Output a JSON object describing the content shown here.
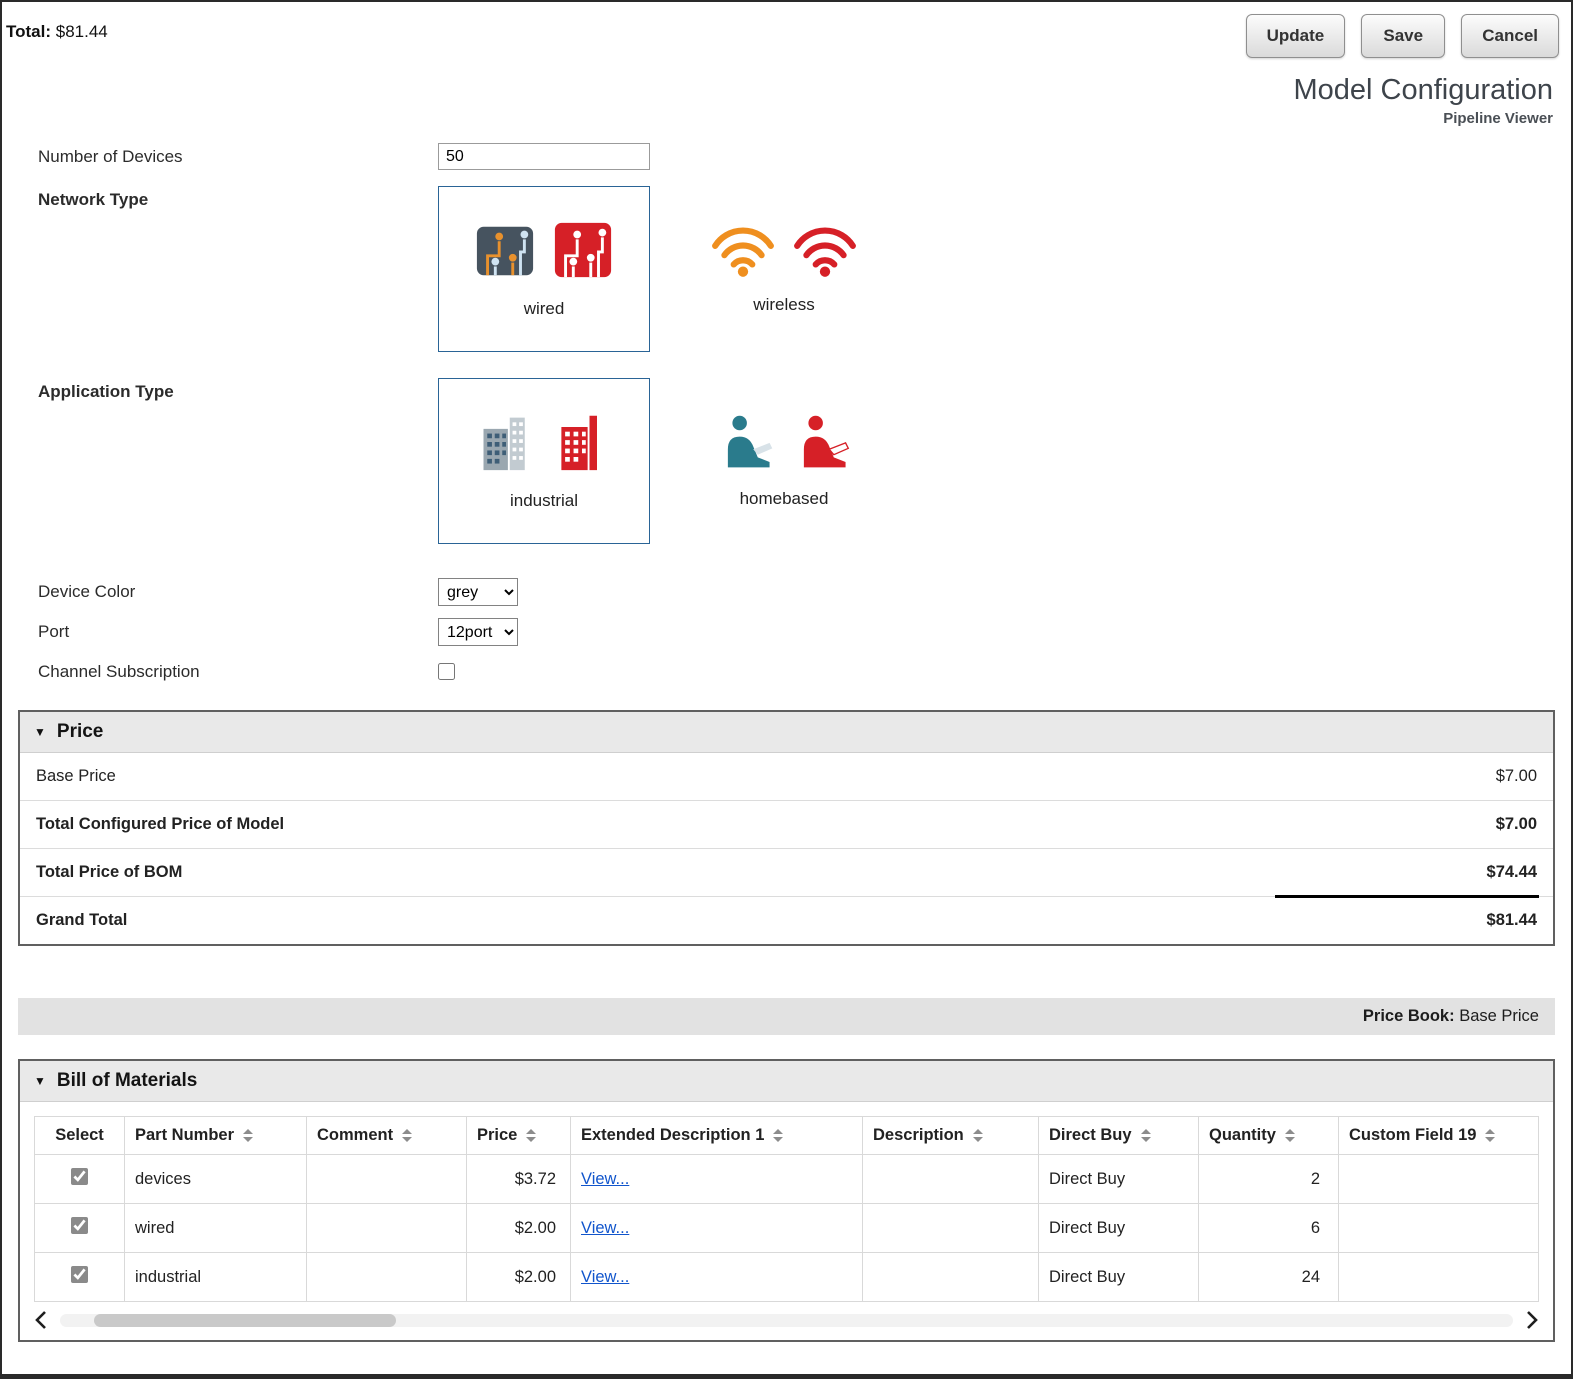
{
  "header": {
    "total_label": "Total:",
    "total_value": "$81.44",
    "buttons": [
      {
        "label": "Update"
      },
      {
        "label": "Save"
      },
      {
        "label": "Cancel"
      }
    ],
    "title": "Model Configuration",
    "subtitle": "Pipeline Viewer"
  },
  "form": {
    "number_of_devices": {
      "label": "Number of Devices",
      "value": "50"
    },
    "network_type": {
      "label": "Network Type",
      "options": [
        {
          "label": "wired",
          "selected": true,
          "icons": [
            "circuit-board-grey-icon",
            "circuit-board-red-icon"
          ]
        },
        {
          "label": "wireless",
          "selected": false,
          "icons": [
            "wifi-orange-icon",
            "wifi-red-icon"
          ]
        }
      ]
    },
    "application_type": {
      "label": "Application Type",
      "options": [
        {
          "label": "industrial",
          "selected": true,
          "icons": [
            "buildings-grey-icon",
            "buildings-red-icon"
          ]
        },
        {
          "label": "homebased",
          "selected": false,
          "icons": [
            "person-laptop-teal-icon",
            "person-laptop-red-icon"
          ]
        }
      ]
    },
    "device_color": {
      "label": "Device Color",
      "value": "grey"
    },
    "port": {
      "label": "Port",
      "value": "12port"
    },
    "channel_subscription": {
      "label": "Channel Subscription",
      "checked": false
    }
  },
  "price": {
    "title": "Price",
    "rows": [
      {
        "label": "Base Price",
        "value": "$7.00"
      },
      {
        "label": "Total Configured Price of Model",
        "value": "$7.00"
      },
      {
        "label": "Total Price of BOM",
        "value": "$74.44"
      },
      {
        "label": "Grand Total",
        "value": "$81.44"
      }
    ]
  },
  "price_book": {
    "label": "Price Book:",
    "value": "Base Price"
  },
  "bom": {
    "title": "Bill of Materials",
    "columns": [
      "Select",
      "Part Number",
      "Comment",
      "Price",
      "Extended Description 1",
      "Description",
      "Direct Buy",
      "Quantity",
      "Custom Field 19"
    ],
    "rows": [
      {
        "selected": true,
        "part_number": "devices",
        "comment": "",
        "price": "$3.72",
        "extended_description_1": "View...",
        "description": "",
        "direct_buy": "Direct Buy",
        "quantity": "2",
        "custom_field_19": ""
      },
      {
        "selected": true,
        "part_number": "wired",
        "comment": "",
        "price": "$2.00",
        "extended_description_1": "View...",
        "description": "",
        "direct_buy": "Direct Buy",
        "quantity": "6",
        "custom_field_19": ""
      },
      {
        "selected": true,
        "part_number": "industrial",
        "comment": "",
        "price": "$2.00",
        "extended_description_1": "View...",
        "description": "",
        "direct_buy": "Direct Buy",
        "quantity": "24",
        "custom_field_19": ""
      }
    ]
  },
  "colors": {
    "selected_border": "#2a6496",
    "link": "#1155cc",
    "red": "#d62027",
    "orange": "#ef8f1f",
    "teal": "#2a7b8c",
    "dark_slate": "#46535f"
  }
}
